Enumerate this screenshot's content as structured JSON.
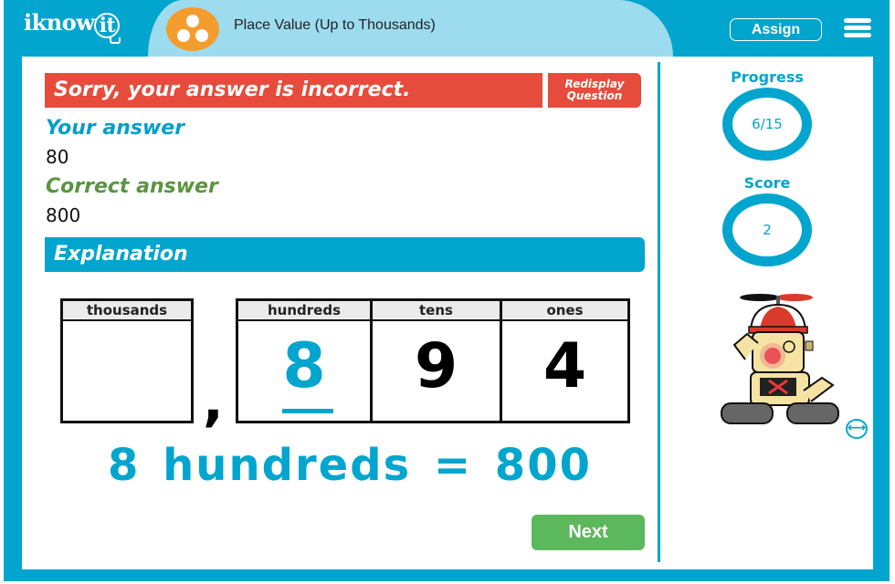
{
  "header": {
    "logo_text": "iknow",
    "logo_bulb_text": "it",
    "title": "Place Value (Up to Thousands)",
    "title_icon": "three-dots-cluster-icon",
    "assign_label": "Assign",
    "menu_icon": "hamburger-menu-icon"
  },
  "feedback": {
    "message": "Sorry, your answer is incorrect.",
    "redisplay_label_line1": "Redisplay",
    "redisplay_label_line2": "Question",
    "your_answer_label": "Your answer",
    "your_answer_value": "80",
    "correct_answer_label": "Correct answer",
    "correct_answer_value": "800",
    "explanation_label": "Explanation"
  },
  "place_value_chart": {
    "thousands": {
      "header": "thousands",
      "digit": ""
    },
    "separator": ",",
    "columns": [
      {
        "header": "hundreds",
        "digit": "8",
        "highlighted": true
      },
      {
        "header": "tens",
        "digit": "9",
        "highlighted": false
      },
      {
        "header": "ones",
        "digit": "4",
        "highlighted": false
      }
    ]
  },
  "summary": {
    "digit": "8",
    "word": "hundreds",
    "equals": "=",
    "value": "800"
  },
  "next_label": "Next",
  "sidebar": {
    "progress_label": "Progress",
    "progress_value": "6/15",
    "score_label": "Score",
    "score_value": "2",
    "mascot": "robot-mascot-incorrect",
    "expand_icon": "expand-horizontal-icon"
  },
  "colors": {
    "brand_blue": "#02a5cd",
    "light_blue": "#9ddcef",
    "error_red": "#e64c3c",
    "correct_green": "#5b9440",
    "next_green": "#5cb85c",
    "title_icon_orange": "#f49c2e"
  }
}
